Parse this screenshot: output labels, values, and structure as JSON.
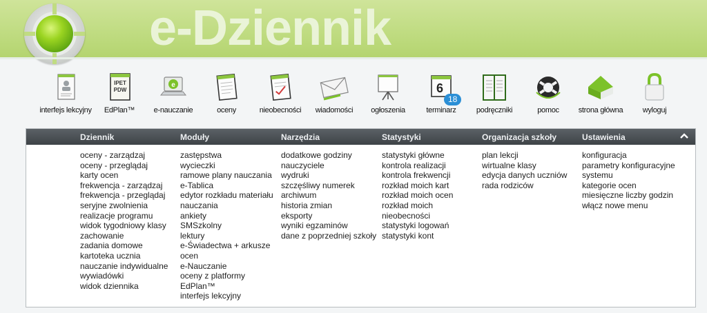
{
  "header": {
    "title": "e-Dziennik"
  },
  "toolbar": {
    "items": [
      {
        "label": "interfejs lekcyjny",
        "icon": "lesson-card-icon"
      },
      {
        "label": "EdPlan™",
        "icon": "edplan-book-icon",
        "icon_text_1": "IPET",
        "icon_text_2": "PDW"
      },
      {
        "label": "e-nauczanie",
        "icon": "laptop-icon"
      },
      {
        "label": "oceny",
        "icon": "grades-notepad-icon"
      },
      {
        "label": "nieobecności",
        "icon": "absence-notepad-icon"
      },
      {
        "label": "wiadomości",
        "icon": "envelope-icon"
      },
      {
        "label": "ogłoszenia",
        "icon": "board-icon"
      },
      {
        "label": "terminarz",
        "icon": "calendar-icon",
        "calendar_day": "6",
        "badge": "18"
      },
      {
        "label": "podręczniki",
        "icon": "books-icon"
      },
      {
        "label": "pomoc",
        "icon": "lifebuoy-icon"
      },
      {
        "label": "strona główna",
        "icon": "home-icon"
      },
      {
        "label": "wyloguj",
        "icon": "padlock-icon"
      }
    ]
  },
  "menu": {
    "columns": [
      {
        "title": "Dziennik",
        "items": [
          "oceny - zarządzaj",
          "oceny - przeglądaj",
          "karty ocen",
          "frekwencja - zarządzaj",
          "frekwencja - przeglądaj",
          "seryjne zwolnienia",
          "realizacje programu",
          "widok tygodniowy klasy",
          "zachowanie",
          "zadania domowe",
          "kartoteka ucznia",
          "nauczanie indywidualne",
          "wywiadówki",
          "widok dziennika"
        ]
      },
      {
        "title": "Moduły",
        "items": [
          "zastępstwa",
          "wycieczki",
          "ramowe plany nauczania",
          "e-Tablica",
          "edytor rozkładu materiału",
          "nauczania",
          "ankiety",
          "SMSzkolny",
          "lektury",
          "e-Świadectwa + arkusze",
          "ocen",
          "e-Nauczanie",
          "oceny z platformy",
          "EdPlan™",
          "interfejs lekcyjny"
        ]
      },
      {
        "title": "Narzędzia",
        "items": [
          "dodatkowe godziny",
          "nauczyciele",
          "wydruki",
          "szczęśliwy numerek",
          "archiwum",
          "historia zmian",
          "eksporty",
          "wyniki egzaminów",
          "dane z poprzedniej szkoły"
        ]
      },
      {
        "title": "Statystyki",
        "items": [
          "statystyki główne",
          "kontrola realizacji",
          "kontrola frekwencji",
          "rozkład moich kart",
          "rozkład moich ocen",
          "rozkład moich",
          "nieobecności",
          "statystyki logowań",
          "statystyki kont"
        ]
      },
      {
        "title": "Organizacja szkoły",
        "items": [
          "plan lekcji",
          "wirtualne klasy",
          "edycja danych uczniów",
          "rada rodziców"
        ]
      },
      {
        "title": "Ustawienia",
        "items": [
          "konfiguracja",
          "parametry konfiguracyjne",
          "systemu",
          "kategorie ocen",
          "miesięczne liczby godzin",
          "włącz nowe menu"
        ]
      }
    ],
    "collapse_icon": "chevron-up-icon"
  },
  "colors": {
    "banner": "#c0dc82",
    "accent_green": "#7cc22a",
    "panel_header": "#4a4f53",
    "badge": "#2b8fd6"
  }
}
